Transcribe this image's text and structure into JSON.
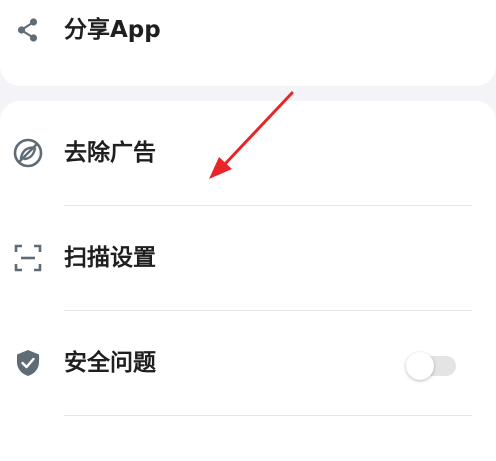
{
  "menu": {
    "share": {
      "label": "分享App",
      "icon": "share-icon"
    },
    "remove_ads": {
      "label": "去除广告",
      "icon": "no-ads-icon"
    },
    "scan_settings": {
      "label": "扫描设置",
      "icon": "scan-frame-icon"
    },
    "security_question": {
      "label": "安全问题",
      "icon": "shield-check-icon",
      "toggle_on": false
    }
  },
  "annotation": {
    "icon": "red-arrow",
    "color": "#e8262a"
  },
  "colors": {
    "background": "#f3f3f8",
    "card": "#ffffff",
    "icon": "#5f6b75",
    "text": "#1f1f1f",
    "divider": "#e6e6e6"
  }
}
